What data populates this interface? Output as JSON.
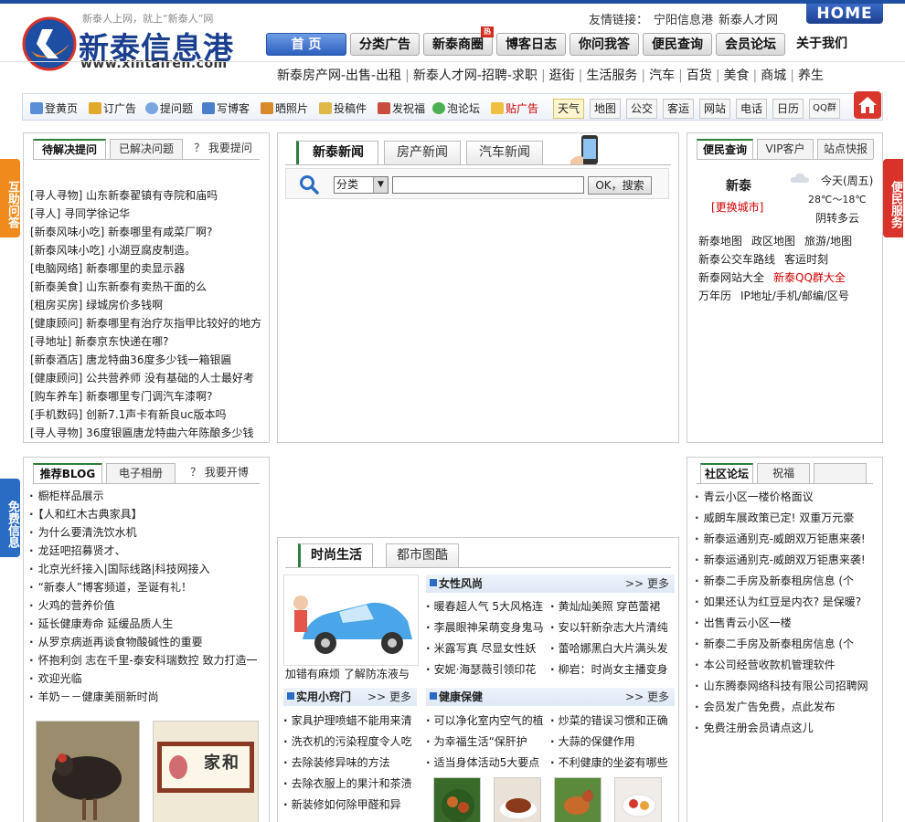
{
  "header": {
    "tagline": "新泰人上网，就上“新泰人”网",
    "logo_name": "新泰信息港",
    "logo_url": "www.xintairen.com",
    "friend_label": "友情链接：",
    "friend_links": [
      "宁阳信息港",
      "新泰人才网"
    ],
    "home_button": "HOME"
  },
  "nav": {
    "items": [
      "首 页",
      "分类广告",
      "新泰商圈",
      "博客日志",
      "你问我答",
      "便民查询",
      "会员论坛",
      "关于我们"
    ],
    "hot_badge": "热"
  },
  "subnav": {
    "items": [
      "新泰房产网-出售-出租",
      "新泰人才网-招聘-求职",
      "逛街",
      "生活服务",
      "汽车",
      "百货",
      "美食",
      "商城",
      "养生"
    ]
  },
  "toolbar": {
    "tools": [
      "登黄页",
      "订广告",
      "提问题",
      "写博客",
      "晒照片",
      "投稿件",
      "发祝福",
      "泡论坛",
      "贴广告"
    ],
    "tabs": [
      "天气",
      "地图",
      "公交",
      "客运",
      "网站",
      "电话",
      "日历",
      "QQ群"
    ]
  },
  "side": {
    "left_top": "互助问答",
    "right_top": "便民服务",
    "left_bottom": "免费信息"
  },
  "qa": {
    "tabs": [
      "待解决提问",
      "已解决问题",
      "？ 我要提问"
    ],
    "items": [
      "[寻人寻物] 山东新泰翟镇有寺院和庙吗",
      "[寻人] 寻同学徐记华",
      "[新泰风味小吃] 新泰哪里有咸菜厂啊?",
      "[新泰风味小吃] 小湖豆腐皮制造。",
      "[电脑网络] 新泰哪里的卖显示器",
      "[新泰美食] 山东新泰有卖热干面的么",
      "[租房买房] 绿城房价多钱啊",
      "[健康顾问] 新泰哪里有治疗灰指甲比较好的地方",
      "[寻地址] 新泰京东快递在哪?",
      "[新泰酒店] 唐龙特曲36度多少钱一箱银匾",
      "[健康顾问] 公共营养师 没有基础的人士最好考",
      "[购车养车] 新泰哪里专门调汽车漆啊?",
      "[手机数码] 创新7.1声卡有新良uc版本吗",
      "[寻人寻物] 36度银匾唐龙特曲六年陈酿多少钱"
    ]
  },
  "news": {
    "tabs": [
      "新泰新闻",
      "房产新闻",
      "汽车新闻"
    ],
    "search_select": "分类",
    "search_button": "OK，搜索"
  },
  "service": {
    "tabs": [
      "便民查询",
      "VIP客户",
      "站点快报"
    ],
    "city": "新泰",
    "change_city": "[更换城市]",
    "weather_day": "今天(周五)",
    "weather_temp": "28℃～18℃",
    "weather_desc": "阴转多云",
    "links": [
      [
        "新泰地图",
        "政区地图",
        "旅游/地图"
      ],
      [
        "新泰公交车路线",
        "客运时刻"
      ],
      [
        "新泰网站大全",
        "新泰QQ群大全"
      ],
      [
        "万年历",
        "IP地址/手机/邮编/区号"
      ]
    ]
  },
  "blog": {
    "tabs": [
      "推荐BLOG",
      "电子相册",
      "？ 我要开博"
    ],
    "items": [
      "橱柜样品展示",
      "【人和红木古典家具】",
      "为什么要清洗饮水机",
      "龙廷吧招募贤才、",
      "北京光纤接入|国际线路|科技网接入",
      "“新泰人”博客频道，圣诞有礼！",
      "火鸡的营养价值",
      "延长健康寿命  延缓品质人生",
      "从罗京病逝再谈食物酸碱性的重要",
      "怀抱利剑 志在千里-泰安科瑞数控 致力打造一",
      "欢迎光临",
      "羊奶－－健康美丽新时尚"
    ],
    "thumb2_text": "家和"
  },
  "life": {
    "tabs": [
      "时尚生活",
      "都市图酷"
    ],
    "car_caption": "加错有麻烦  了解防冻液与",
    "women": {
      "title": "女性风尚",
      "more": "更多",
      "col1": [
        "暖春超人气 5大风格连",
        "李晨眼神呆萌变身鬼马",
        "米露写真 尽显女性妖",
        "安妮·海瑟薇引领印花"
      ],
      "col2": [
        "黄灿灿美照 穿芭蕾裙",
        "安以轩新杂志大片清纯",
        "蕾哈娜黑白大片满头发",
        "柳岩：时尚女主播变身"
      ]
    },
    "tips": {
      "title": "实用小窍门",
      "more": "更多",
      "items": [
        "家具护理喷蜡不能用来清",
        "洗衣机的污染程度令人吃",
        "去除装修异味的方法",
        "去除衣服上的果汁和茶渍",
        "新装修如何除甲醛和异"
      ]
    },
    "health": {
      "title": "健康保健",
      "more": "更多",
      "col1": [
        "可以净化室内空气的植",
        "为幸福生活“保肝护",
        "适当身体活动5大要点"
      ],
      "col2": [
        "炒菜的错误习惯和正确",
        "大蒜的保健作用",
        "不利健康的坐姿有哪些"
      ]
    }
  },
  "forum": {
    "tabs": [
      "社区论坛",
      "祝福",
      ""
    ],
    "items": [
      "青云小区一楼价格面议",
      "威朗车展政策已定! 双重万元豪",
      "新泰运通别克-威朗双万钜惠来袭!",
      "新泰运通别克-威朗双万钜惠来袭!",
      "新泰二手房及新泰租房信息 (个",
      "如果还认为红豆是内衣? 是保暖?",
      "出售青云小区一楼",
      "新泰二手房及新泰租房信息 (个",
      "本公司经营收款机管理软件",
      "山东腾泰网络科技有限公司招聘网",
      "会员发广告免费，点此发布",
      "免费注册会员请点这儿"
    ]
  }
}
